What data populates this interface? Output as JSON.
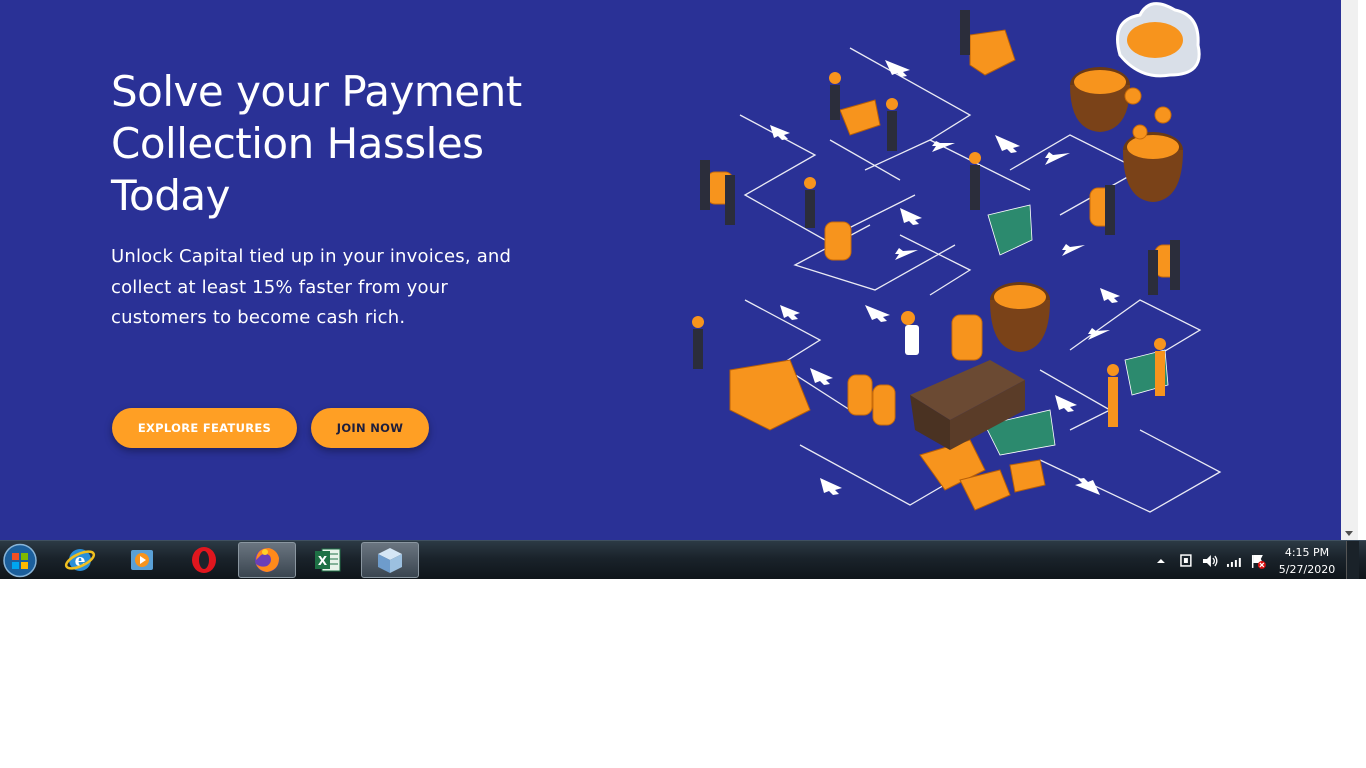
{
  "hero": {
    "title_lines": [
      "Solve your Payment",
      "Collection Hassles",
      "Today"
    ],
    "subtitle_lines": [
      "Unlock Capital tied up in your invoices, and",
      "collect at least 15% faster from your",
      "customers to become cash rich."
    ],
    "explore_button": "EXPLORE FEATURES",
    "join_button": "JOIN NOW",
    "illustration_icon": "payment-flow-isometric-illustration"
  },
  "colors": {
    "hero_background": "#2a3196",
    "button": "#ff9f24",
    "accent_orange": "#f7941d"
  },
  "taskbar": {
    "apps": [
      {
        "name": "internet-explorer-icon",
        "active": false
      },
      {
        "name": "media-player-icon",
        "active": false
      },
      {
        "name": "opera-icon",
        "active": false
      },
      {
        "name": "firefox-icon",
        "active": true
      },
      {
        "name": "excel-icon",
        "active": false
      },
      {
        "name": "virtualbox-icon",
        "active": false
      }
    ],
    "tray_icons": [
      "show-hidden-icons-arrow",
      "network-adapter-icon",
      "volume-icon",
      "signal-icon",
      "action-center-flag-icon"
    ],
    "time": "4:15 PM",
    "date": "5/27/2020"
  }
}
